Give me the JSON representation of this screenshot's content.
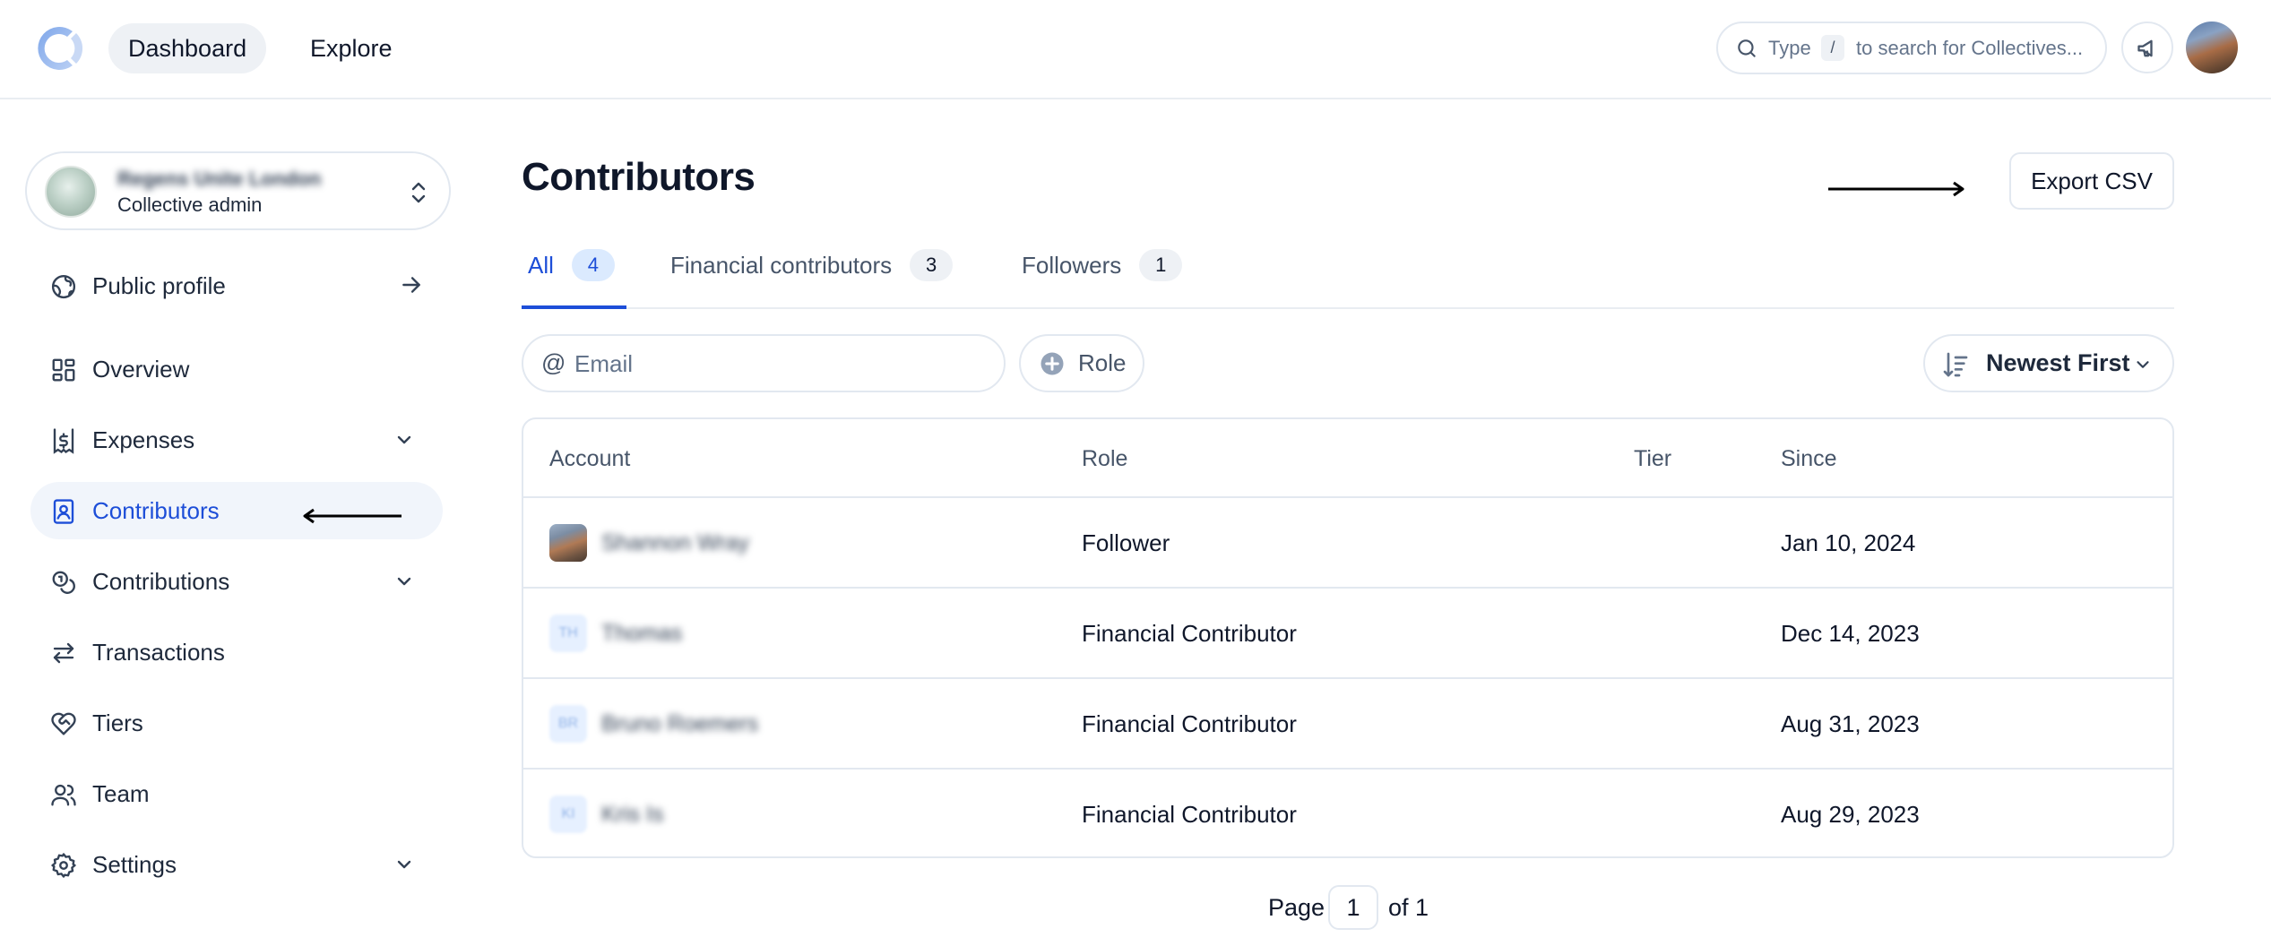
{
  "topbar": {
    "nav": [
      {
        "label": "Dashboard"
      },
      {
        "label": "Explore"
      }
    ],
    "search": {
      "pre": "Type",
      "key": "/",
      "post": "to search for Collectives..."
    }
  },
  "account": {
    "name": "Regens Unite London",
    "role": "Collective admin"
  },
  "sidebar": {
    "items": [
      {
        "label": "Public profile",
        "icon": "globe-icon"
      },
      {
        "label": "Overview",
        "icon": "grid-icon"
      },
      {
        "label": "Expenses",
        "icon": "receipt-dollar-icon"
      },
      {
        "label": "Contributors",
        "icon": "contact-book-icon"
      },
      {
        "label": "Contributions",
        "icon": "coins-icon"
      },
      {
        "label": "Transactions",
        "icon": "arrows-left-right-icon"
      },
      {
        "label": "Tiers",
        "icon": "heart-handshake-icon"
      },
      {
        "label": "Team",
        "icon": "users-icon"
      },
      {
        "label": "Settings",
        "icon": "gear-icon"
      }
    ],
    "active": "Contributors"
  },
  "main": {
    "title": "Contributors",
    "export_label": "Export CSV",
    "tabs": [
      {
        "label": "All",
        "count": "4"
      },
      {
        "label": "Financial contributors",
        "count": "3"
      },
      {
        "label": "Followers",
        "count": "1"
      }
    ],
    "filters": {
      "email_prefix": "@",
      "email_placeholder": "Email",
      "role_label": "Role",
      "sort_label": "Newest First"
    },
    "table": {
      "columns": [
        "Account",
        "Role",
        "Tier",
        "Since"
      ],
      "rows": [
        {
          "account": "Shannon Wray",
          "initials": "",
          "role": "Follower",
          "tier": "",
          "since": "Jan 10, 2024"
        },
        {
          "account": "Thomas",
          "initials": "TH",
          "role": "Financial Contributor",
          "tier": "",
          "since": "Dec 14, 2023"
        },
        {
          "account": "Bruno Roemers",
          "initials": "BR",
          "role": "Financial Contributor",
          "tier": "",
          "since": "Aug 31, 2023"
        },
        {
          "account": "Kris Is",
          "initials": "KI",
          "role": "Financial Contributor",
          "tier": "",
          "since": "Aug 29, 2023"
        }
      ]
    },
    "pagination": {
      "prefix": "Page",
      "current": "1",
      "suffix": "of 1"
    }
  },
  "colors": {
    "accent": "#1d4ed8",
    "active_bg": "#f1f5fb",
    "border": "#e2e8f0"
  }
}
